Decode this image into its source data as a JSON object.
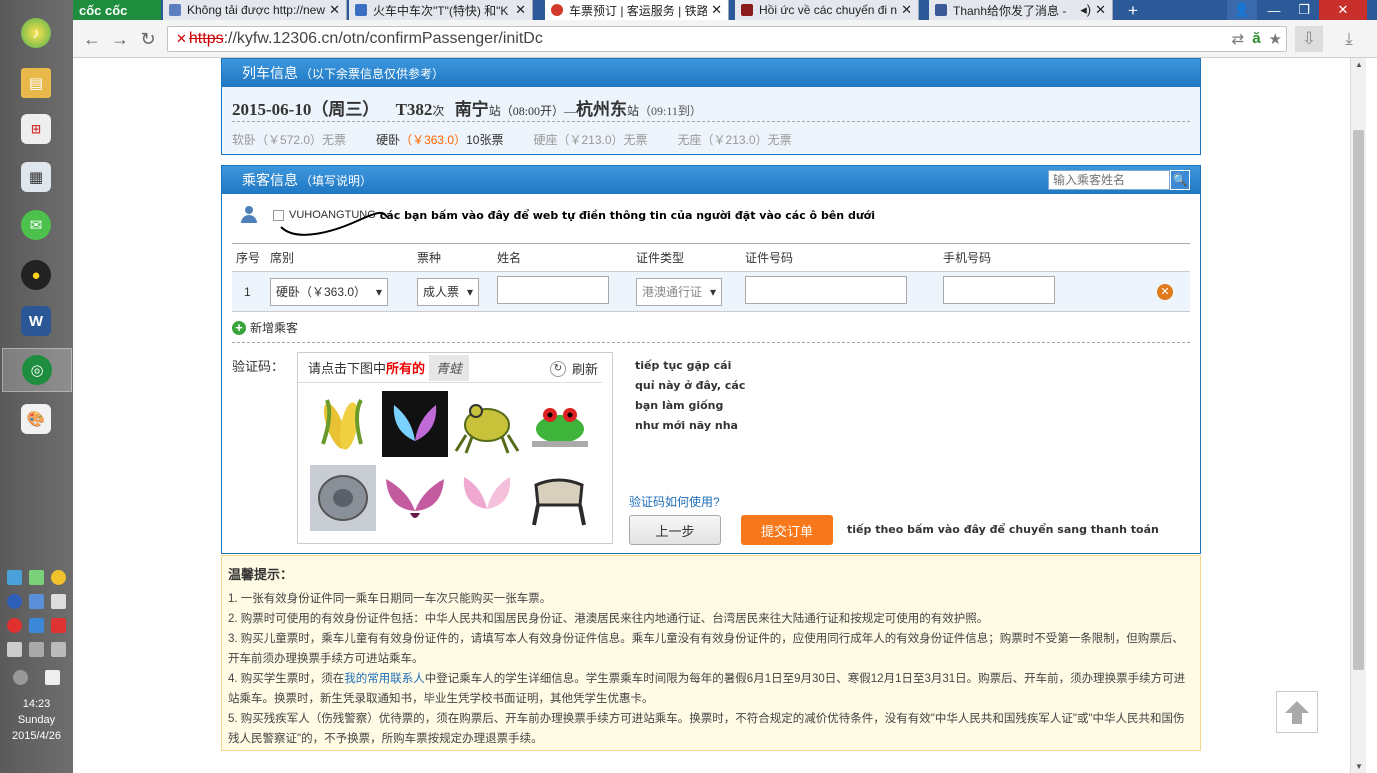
{
  "browser": {
    "logo": "cốc cốc",
    "tabs": [
      {
        "label": "Không tải được http://new",
        "color": "#5a7ec0"
      },
      {
        "label": "火车中车次\"T\"(特快) 和\"K",
        "color": "#3b6fc2"
      },
      {
        "label": "车票预订 | 客运服务 | 铁路",
        "color": "#d13a2b",
        "active": true
      },
      {
        "label": "Hồi ức về các chuyến đi nư",
        "color": "#8b1a1a"
      },
      {
        "label": "Thanh给你发了消息 -",
        "color": "#3b5998"
      }
    ],
    "url_scheme": "https",
    "url_rest": "://kyfw.12306.cn/otn/confirmPassenger/initDc"
  },
  "train": {
    "header": "列车信息",
    "header_note": "（以下余票信息仅供参考）",
    "date": "2015-06-10（周三）",
    "train_no": "T382",
    "train_suffix": "次",
    "from": "南宁",
    "from_suffix": "站（08:00开）—",
    "to": "杭州东",
    "to_suffix": "站",
    "arrive": "（09:11到）",
    "seats": [
      {
        "name": "软卧",
        "price": "（￥572.0）",
        "status": "无票",
        "available": false
      },
      {
        "name": "硬卧",
        "price": "（￥363.0）",
        "status": "10张票",
        "available": true
      },
      {
        "name": "硬座",
        "price": "（￥213.0）",
        "status": "无票",
        "available": false
      },
      {
        "name": "无座",
        "price": "（￥213.0）",
        "status": "无票",
        "available": false
      }
    ]
  },
  "passenger": {
    "header": "乘客信息",
    "header_note": "（填写说明）",
    "search_placeholder": "输入乘客姓名",
    "contact_name": "VUHOANGTUNG",
    "annotation_1": "các bạn bấm vào đây để web tự điền thông tin của người đặt vào các ô bên dưới",
    "columns": [
      "序号",
      "席别",
      "票种",
      "姓名",
      "证件类型",
      "证件号码",
      "手机号码"
    ],
    "rows": [
      {
        "index": "1",
        "seat": "硬卧（￥363.0）",
        "ticket_type": "成人票",
        "name": "",
        "id_type": "港澳通行证",
        "id_no": "",
        "phone": ""
      }
    ],
    "add_label": "新增乘客"
  },
  "captcha": {
    "label": "验证码：",
    "instruction": "请点击下图中",
    "instruction_bold": "所有的",
    "word": "青蛙",
    "refresh": "刷新",
    "images": [
      "corn",
      "wings-dark",
      "frog-yellow",
      "frog-red-eye",
      "cookware",
      "wings-pink",
      "wings-light",
      "chair"
    ],
    "note_lines": [
      "tiếp tục gặp cái",
      "quỉ này ở đây, các",
      "bạn làm giống",
      "như mới nãy nha"
    ],
    "help": "验证码如何使用?"
  },
  "actions": {
    "prev": "上一步",
    "submit": "提交订单",
    "annotation_2": "tiếp theo bấm vào đây để chuyển sang thanh toán"
  },
  "tips": {
    "title": "温馨提示：",
    "items": [
      "1. 一张有效身份证件同一乘车日期同一车次只能购买一张车票。",
      "2. 购票时可使用的有效身份证件包括：中华人民共和国居民身份证、港澳居民来往内地通行证、台湾居民来往大陆通行证和按规定可使用的有效护照。",
      "3. 购买儿童票时，乘车儿童有有效身份证件的，请填写本人有效身份证件信息。乘车儿童没有有效身份证件的，应使用同行成年人的有效身份证件信息；购票时不受第一条限制，但购票后、开车前须办理换票手续方可进站乘车。",
      "4. 购买学生票时，须在",
      "5. 购买残疾军人（伤残警察）优待票的，须在购票后、开车前办理换票手续方可进站乘车。换票时，不符合规定的减价优待条件，没有有效\"中华人民共和国残疾军人证\"或\"中华人民共和国伤残人民警察证\"的，不予换票，所购车票按规定办理退票手续。"
    ],
    "item4_link": "我的常用联系人",
    "item4_rest": "中登记乘车人的学生详细信息。学生票乘车时间限为每年的暑假6月1日至9月30日、寒假12月1日至3月31日。购票后、开车前，须办理换票手续方可进站乘车。换票时，新生凭录取通知书，毕业生凭学校书面证明，其他凭学生优惠卡。"
  },
  "system": {
    "time": "14:23",
    "day": "Sunday",
    "date": "2015/4/26"
  }
}
